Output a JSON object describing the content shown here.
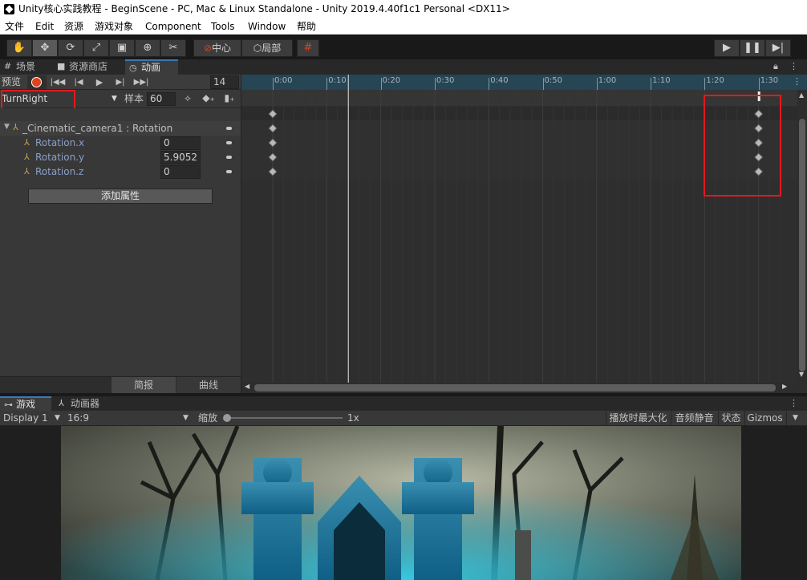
{
  "window": {
    "title": "Unity核心实践教程 - BeginScene - PC, Mac & Linux Standalone - Unity 2019.4.40f1c1 Personal <DX11>"
  },
  "menu": [
    "文件",
    "Edit",
    "资源",
    "游戏对象",
    "Component",
    "Tools",
    "Window",
    "帮助"
  ],
  "toolbar": {
    "tools": [
      "hand-icon",
      "move-icon",
      "rotate-icon",
      "scale-icon",
      "rect-icon",
      "transform-icon",
      "custom-tool-icon"
    ],
    "pivot_label": "中心",
    "space_label": "局部",
    "grid_icon": "grid-snap-icon",
    "play_icons": [
      "play-icon",
      "pause-icon",
      "step-icon"
    ]
  },
  "tabs": {
    "scene": "场景",
    "asset_store": "资源商店",
    "animation": "动画"
  },
  "animation": {
    "preview_label": "预览",
    "frame_value": "14",
    "clip_name": "TurnRight",
    "sample_label": "样本",
    "sample_value": "60",
    "object_label": "_Cinematic_camera1 : Rotation",
    "properties": [
      {
        "name": "Rotation.x",
        "value": "0"
      },
      {
        "name": "Rotation.y",
        "value": "5.9052"
      },
      {
        "name": "Rotation.z",
        "value": "0"
      }
    ],
    "add_property_label": "添加属性",
    "dopesheet_label": "简报",
    "curves_label": "曲线",
    "ruler_labels": [
      "0:00",
      "0:10",
      "0:20",
      "0:30",
      "0:40",
      "0:50",
      "1:00",
      "1:10",
      "1:20",
      "1:30"
    ],
    "keyframe_frames": [
      0,
      90
    ]
  },
  "game": {
    "tab_game": "游戏",
    "tab_animator": "动画器",
    "display": "Display 1",
    "aspect": "16:9",
    "scale_label": "缩放",
    "scale_value": "1x",
    "maximize_label": "播放时最大化",
    "mute_label": "音频静音",
    "stats_label": "状态",
    "gizmos_label": "Gizmos"
  },
  "colors": {
    "accent": "#3a79bb",
    "highlight_box": "#e1191e",
    "record": "#e0421e",
    "ruler_bg": "#264555"
  }
}
